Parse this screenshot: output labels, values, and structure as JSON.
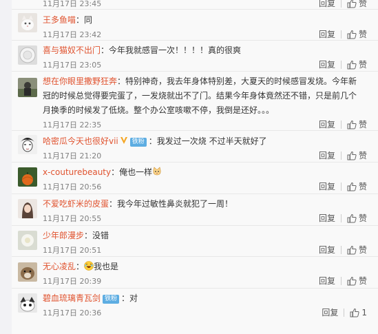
{
  "comments": [
    {
      "user": "",
      "text": "",
      "time": "11月17日 23:45",
      "reply": "回复",
      "like": "赞"
    },
    {
      "user": "王多鱼喵",
      "text": "：同",
      "time": "11月17日 23:42",
      "reply": "回复",
      "like": "赞"
    },
    {
      "user": "喜与猫奴不出门",
      "text": "：今年我就感冒一次！！！！真的很爽",
      "time": "11月17日 23:05",
      "reply": "回复",
      "like": "赞"
    },
    {
      "user": "想在你眼里撒野狂奔",
      "text": "：特别神奇，我去年身体特别差，大夏天的时候感冒发烧。今年新冠的时候总觉得要完蛋了，一发烧就出不了门。结果今年身体竟然还不错，只是前几个月换季的时候发了低烧。整个办公室咳嗽不停，我倒是还好。。。",
      "time": "11月17日 22:35",
      "reply": "回复",
      "like": "赞"
    },
    {
      "user": "哈密瓜今天也很好vii",
      "badge": "铁粉",
      "text": "：我发过一次烧 不过半天就好了",
      "time": "11月17日 21:20",
      "reply": "回复",
      "like": "赞"
    },
    {
      "user": "x-couturebeauty",
      "text": "：俺也一样",
      "time": "11月17日 20:56",
      "reply": "回复",
      "like": "赞"
    },
    {
      "user": "不爱吃虾米的皮蛋",
      "text": "：我今年过敏性鼻炎就犯了一周！",
      "time": "11月17日 20:55",
      "reply": "回复",
      "like": "赞"
    },
    {
      "user": "少年郎漫步",
      "text": "：没错",
      "time": "11月17日 20:51",
      "reply": "回复",
      "like": "赞"
    },
    {
      "user": "无心凌乱",
      "text": "我也是",
      "time": "11月17日 20:39",
      "reply": "回复",
      "like": "赞"
    },
    {
      "user": "碧血琉璃青瓦剑",
      "badge": "铁粉",
      "text": "：对",
      "time": "11月17日 20:36",
      "reply": "回复",
      "like": "1"
    }
  ],
  "colors": {
    "username": "#e0532f",
    "time": "#808080",
    "badge": "#5dade2"
  }
}
